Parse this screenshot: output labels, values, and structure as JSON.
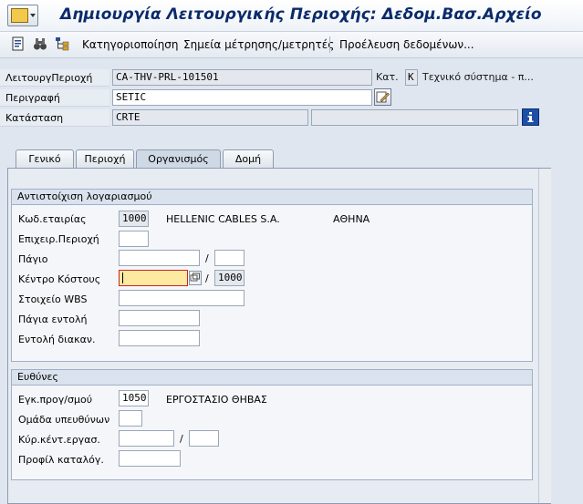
{
  "window": {
    "title": "Δημιουργία Λειτουργικής Περιοχής: Δεδομ.Βασ.Αρχείο"
  },
  "toolbar": {
    "items": [
      {
        "label": "Κατηγοριοποίηση"
      },
      {
        "label": "Σημεία μέτρησης/μετρητές"
      },
      {
        "label": "Προέλευση δεδομένων..."
      }
    ]
  },
  "header": {
    "funcloc_label": "ΛειτουργΠεριοχή",
    "funcloc_value": "CA-THV-PRL-101501",
    "cat_label": "Κατ.",
    "cat_value": "K",
    "cat_text": "Τεχνικό σύστημα - π...",
    "desc_label": "Περιγραφή",
    "desc_value": "SETIC",
    "status_label": "Κατάσταση",
    "status_value": "CRTE",
    "status_value2": ""
  },
  "tabs": [
    {
      "label": "Γενικό"
    },
    {
      "label": "Περιοχή"
    },
    {
      "label": "Οργανισμός"
    },
    {
      "label": "Δομή"
    }
  ],
  "account_group": {
    "title": "Αντιστοίχιση λογαριασμού",
    "company_code_label": "Κωδ.εταιρίας",
    "company_code_value": "1000",
    "company_name": "HELLENIC CABLES S.A.",
    "company_city": "ΑΘΗΝΑ",
    "business_area_label": "Επιχειρ.Περιοχή",
    "business_area_value": "",
    "asset_label": "Πάγιο",
    "asset_value": "",
    "asset_sub_value": "",
    "cost_center_label": "Κέντρο Κόστους",
    "cost_center_value": "",
    "controlling_area_value": "1000",
    "wbs_label": "Στοιχείο WBS",
    "wbs_value": "",
    "standing_order_label": "Πάγια εντολή",
    "standing_order_value": "",
    "settlement_order_label": "Εντολή διακαν.",
    "settlement_order_value": "",
    "slash": "/"
  },
  "resp_group": {
    "title": "Ευθύνες",
    "planning_plant_label": "Εγκ.προγ/σμού",
    "planning_plant_value": "1050",
    "planning_plant_name": "ΕΡΓΟΣΤΑΣΙΟ ΘΗΒΑΣ",
    "planner_group_label": "Ομάδα υπευθύνων",
    "planner_group_value": "",
    "main_workctr_label": "Κύρ.κέντ.εργασ.",
    "main_workctr_value": "",
    "main_workctr_plant_value": "",
    "catalog_profile_label": "Προφίλ καταλόγ.",
    "catalog_profile_value": "",
    "slash": "/"
  },
  "colors": {
    "title": "#0a2a6a",
    "focus_field": "#fbeaa0",
    "focus_border": "#d0202a"
  }
}
